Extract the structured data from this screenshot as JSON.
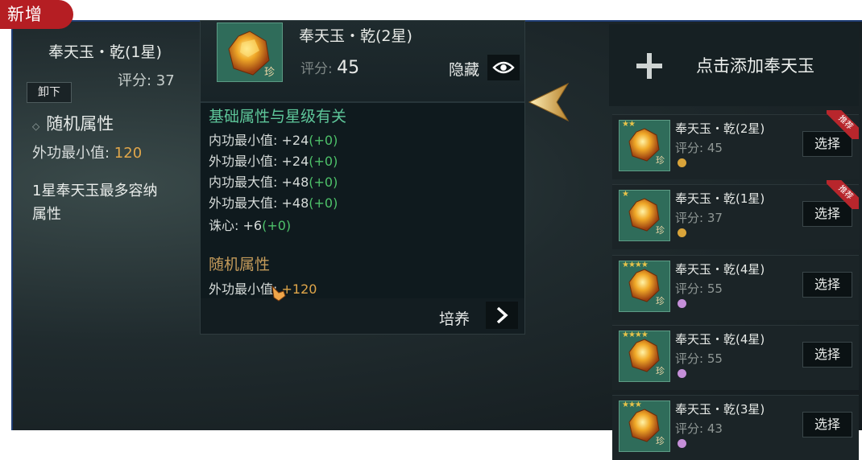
{
  "badge": "新增",
  "left_panel": {
    "title": "奉天玉・乾(1星)",
    "score": "评分: 37",
    "unload_button": "卸下",
    "random_attr_title": "随机属性",
    "stat_label": "外功最小值: ",
    "stat_value": "120",
    "note_line1": "1星奉天玉最多容纳",
    "note_line2": "属性"
  },
  "tooltip": {
    "title": "奉天玉・乾(2星)",
    "icon_tag": "珍",
    "score_label": "评分:",
    "score_value": "45",
    "hide_label": "隐藏",
    "section_basic": "基础属性与星级有关",
    "attributes": [
      {
        "label": "内功最小值: +24",
        "bonus": "(+0)"
      },
      {
        "label": "外功最小值: +24",
        "bonus": "(+0)"
      },
      {
        "label": "内功最大值: +48",
        "bonus": "(+0)"
      },
      {
        "label": "外功最大值: +48",
        "bonus": "(+0)"
      },
      {
        "label": "诛心: +6",
        "bonus": "(+0)"
      }
    ],
    "section_random": "随机属性",
    "random_attr_label": "外功最小值: ",
    "random_attr_value": "+120",
    "cultivate_label": "培养"
  },
  "right_panel": {
    "add_label": "点击添加奉天玉",
    "cards": [
      {
        "name": "奉天玉・乾(2星)",
        "score": "评分: 45",
        "stars": "★★",
        "tag": "珍",
        "select": "选择",
        "ribbon": "推荐",
        "dot_color": "#d9a43a"
      },
      {
        "name": "奉天玉・乾(1星)",
        "score": "评分: 37",
        "stars": "★",
        "tag": "珍",
        "select": "选择",
        "ribbon": "推荐",
        "dot_color": "#d9a43a"
      },
      {
        "name": "奉天玉・乾(4星)",
        "score": "评分: 55",
        "stars": "★★★★",
        "tag": "珍",
        "select": "选择",
        "ribbon": "",
        "dot_color": "#c58fd9"
      },
      {
        "name": "奉天玉・乾(4星)",
        "score": "评分: 55",
        "stars": "★★★★",
        "tag": "珍",
        "select": "选择",
        "ribbon": "",
        "dot_color": "#c58fd9"
      },
      {
        "name": "奉天玉・乾(3星)",
        "score": "评分: 43",
        "stars": "★★★",
        "tag": "珍",
        "select": "选择",
        "ribbon": "",
        "dot_color": "#c58fd9"
      }
    ]
  },
  "colors": {
    "badge_bg": "#b51e23",
    "accent_green": "#5ec79a",
    "bonus_green": "#4ec26a",
    "accent_orange": "#e0a64a",
    "section_gold": "#c39a5a"
  },
  "icons": [
    "eye-icon",
    "chevron-right-icon",
    "plus-icon",
    "gold-arrow-icon",
    "gem-icon",
    "hand-cursor-icon"
  ]
}
